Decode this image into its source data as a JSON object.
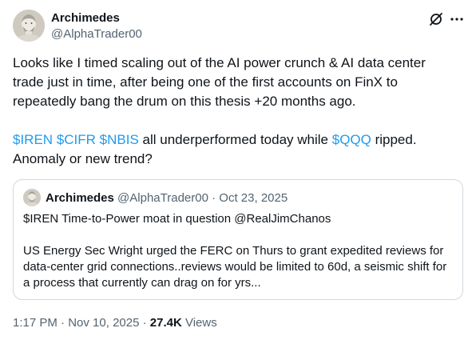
{
  "author": {
    "name": "Archimedes",
    "handle": "@AlphaTrader00"
  },
  "icons": {
    "grok": "grok-icon",
    "more": "more-icon"
  },
  "tweet": {
    "text": "Looks like I timed scaling out of the AI power crunch & AI data center\ntrade just in time, after being one of the first accounts on FinX to\nrepeatedly bang the drum on this thesis +20 months ago.",
    "cashtags": [
      "$IREN",
      "$CIFR",
      "$NBIS"
    ],
    "text_mid": " all underperformed today while ",
    "cashtag_qqq": "$QQQ",
    "text_end": " ripped.",
    "text_line2": "Anomaly or new trend?"
  },
  "quote": {
    "name": "Archimedes",
    "handle": "@AlphaTrader00",
    "separator": " · ",
    "date": "Oct 23, 2025",
    "title": "$IREN Time-to-Power moat in question @RealJimChanos",
    "body": "US Energy Sec Wright urged the FERC on Thurs to grant expedited reviews for data-center grid connections..reviews would be limited to 60d, a seismic shift for a process that currently can drag on for yrs..."
  },
  "footer": {
    "time": "1:17 PM",
    "separator": " · ",
    "date": "Nov 10, 2025",
    "views_count": "27.4K",
    "views_label": " Views"
  },
  "colors": {
    "link": "#1d9bf0",
    "secondary_text": "#536471",
    "primary_text": "#0f1419",
    "border": "#cfd9de"
  }
}
